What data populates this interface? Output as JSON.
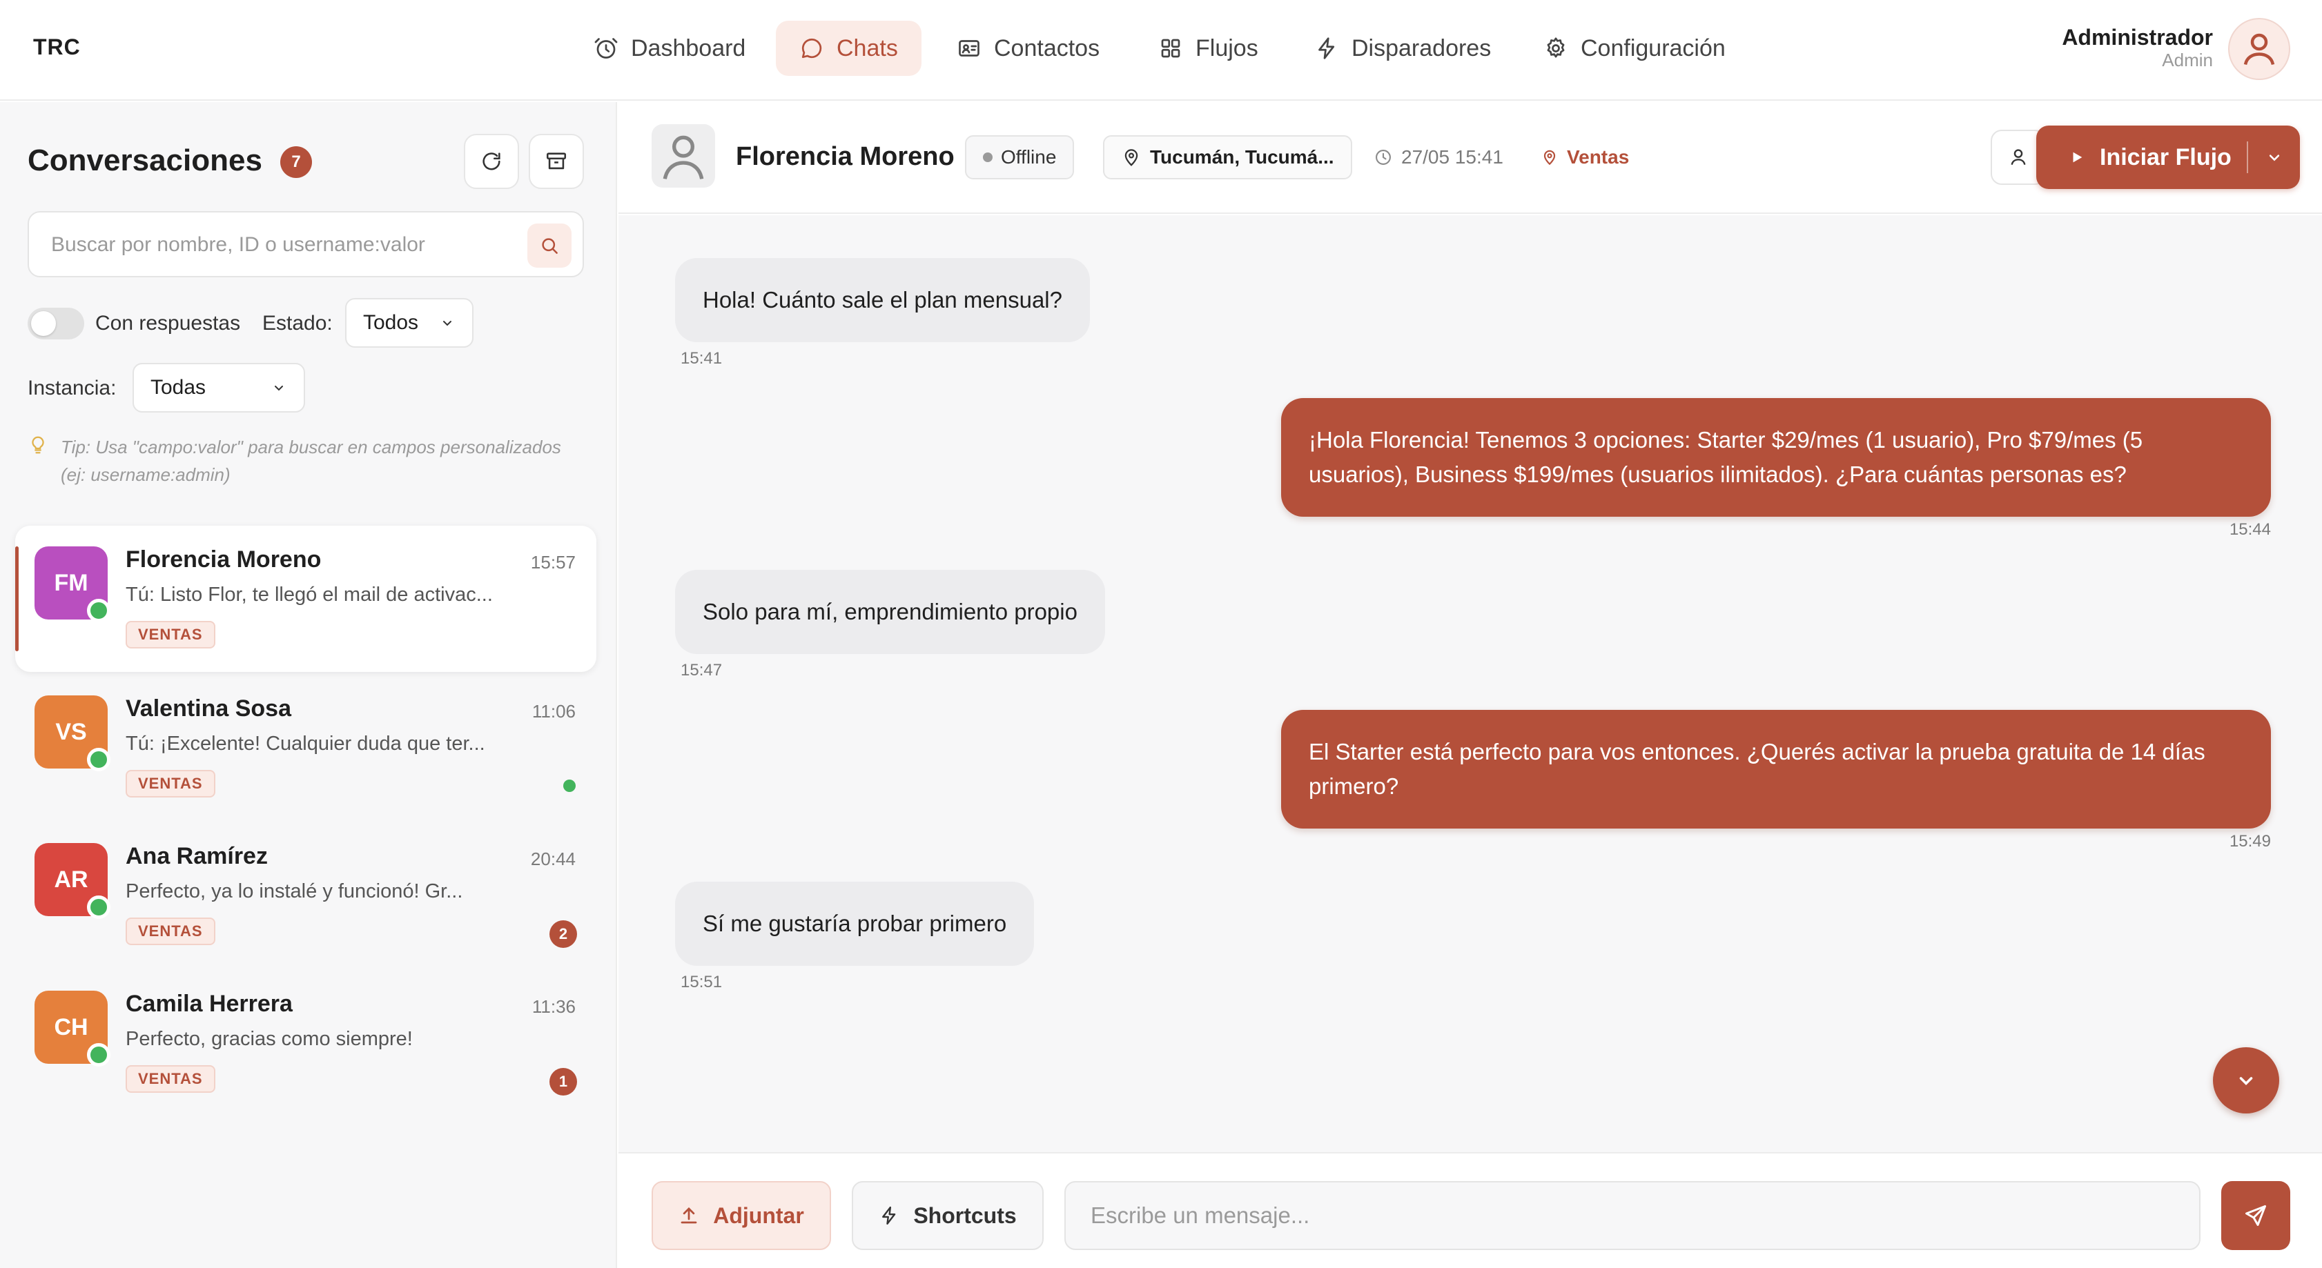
{
  "app": {
    "logo": "TRC"
  },
  "nav": {
    "items": [
      {
        "label": "Dashboard",
        "icon": "clock-icon",
        "active": false
      },
      {
        "label": "Chats",
        "icon": "chat-icon",
        "active": true
      },
      {
        "label": "Contactos",
        "icon": "contact-card-icon",
        "active": false
      },
      {
        "label": "Flujos",
        "icon": "grid-icon",
        "active": false
      },
      {
        "label": "Disparadores",
        "icon": "lightning-icon",
        "active": false
      },
      {
        "label": "Configuración",
        "icon": "gear-icon",
        "active": false
      }
    ]
  },
  "user": {
    "name": "Administrador",
    "role": "Admin"
  },
  "sidebar": {
    "title": "Conversaciones",
    "count": "7",
    "search_placeholder": "Buscar por nombre, ID o username:valor",
    "toggle_label": "Con respuestas",
    "estado_label": "Estado:",
    "estado_value": "Todos",
    "instancia_label": "Instancia:",
    "instancia_value": "Todas",
    "tip": "Tip: Usa \"campo:valor\" para buscar en campos personalizados (ej: username:admin)"
  },
  "conversations": [
    {
      "initials": "FM",
      "name": "Florencia Moreno",
      "time": "15:57",
      "preview": "Tú: Listo Flor, te llegó el mail de activac...",
      "tag": "VENTAS",
      "color": "#b94fbf",
      "unread": ""
    },
    {
      "initials": "VS",
      "name": "Valentina Sosa",
      "time": "11:06",
      "preview": "Tú: ¡Excelente! Cualquier duda que ter...",
      "tag": "VENTAS",
      "color": "#e5803c",
      "unread": ""
    },
    {
      "initials": "AR",
      "name": "Ana Ramírez",
      "time": "20:44",
      "preview": "Perfecto, ya lo instalé y funcionó! Gr...",
      "tag": "VENTAS",
      "color": "#d9473f",
      "unread": "2"
    },
    {
      "initials": "CH",
      "name": "Camila Herrera",
      "time": "11:36",
      "preview": "Perfecto, gracias como siempre!",
      "tag": "VENTAS",
      "color": "#e5803c",
      "unread": "1"
    }
  ],
  "chat": {
    "name": "Florencia Moreno",
    "status": "Offline",
    "location": "Tucumán, Tucumá...",
    "last_seen": "27/05 15:41",
    "tag": "Ventas",
    "flow_button": "Iniciar Flujo"
  },
  "messages": [
    {
      "dir": "in",
      "text": "Hola! Cuánto sale el plan mensual?",
      "time": "15:41"
    },
    {
      "dir": "out",
      "text": "¡Hola Florencia! Tenemos 3 opciones: Starter $29/mes (1 usuario), Pro $79/mes (5 usuarios), Business $199/mes (usuarios ilimitados). ¿Para cuántas personas es?",
      "time": "15:44"
    },
    {
      "dir": "in",
      "text": "Solo para mí, emprendimiento propio",
      "time": "15:47"
    },
    {
      "dir": "out",
      "text": "El Starter está perfecto para vos entonces. ¿Querés activar la prueba gratuita de 14 días primero?",
      "time": "15:49"
    },
    {
      "dir": "in",
      "text": "Sí me gustaría probar primero",
      "time": "15:51"
    }
  ],
  "composer": {
    "attach_label": "Adjuntar",
    "shortcuts_label": "Shortcuts",
    "placeholder": "Escribe un mensaje..."
  },
  "colors": {
    "accent": "#b4503a",
    "accent_soft": "#fbebe6",
    "online": "#43b45c"
  }
}
